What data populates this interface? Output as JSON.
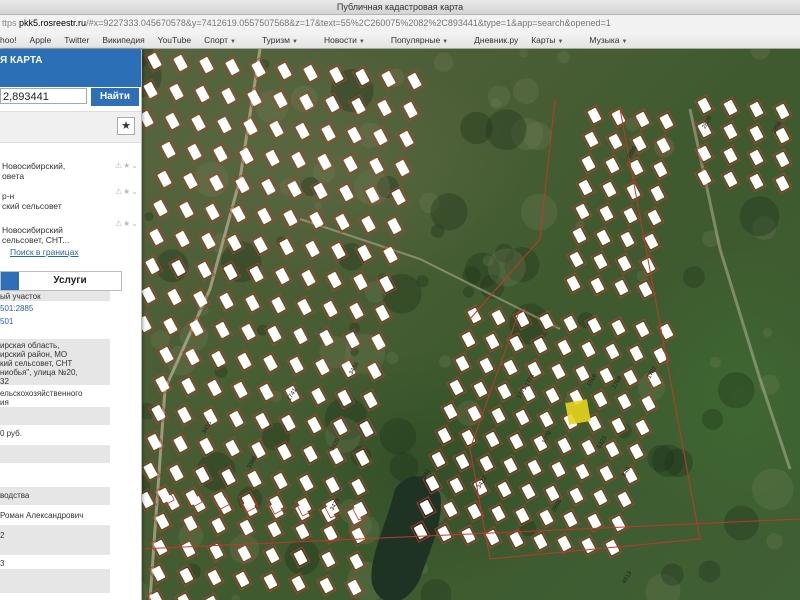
{
  "browser": {
    "window_title": "Публичная кадастровая карта",
    "url_scheme": "ttps",
    "url_host": "pkk5.rosreestr.ru",
    "url_path": "/#x=9227333.045670578&y=7412619.0557507568&z=17&text=55%2C260075%2082%2C893441&type=1&app=search&opened=1",
    "bookmarks": [
      {
        "label": "hoo!",
        "menu": false
      },
      {
        "label": "Apple",
        "menu": false
      },
      {
        "label": "Twitter",
        "menu": false
      },
      {
        "label": "Википедия",
        "menu": false
      },
      {
        "label": "YouTube",
        "menu": false
      },
      {
        "label": "Спорт",
        "menu": true
      },
      {
        "label": "Туризм",
        "menu": true
      },
      {
        "label": "Новости",
        "menu": true
      },
      {
        "label": "Популярные",
        "menu": true
      },
      {
        "label": "Дневник.ру",
        "menu": false
      },
      {
        "label": "Карты",
        "menu": true
      },
      {
        "label": "Музыка",
        "menu": true
      }
    ]
  },
  "panel": {
    "title": "Я КАРТА",
    "search_value": "2,893441",
    "search_button": "Найти",
    "star": "★",
    "tree": [
      {
        "lines": [
          "Новосибирский,",
          "овета"
        ]
      },
      {
        "lines": [
          "р-н",
          "ский сельсовет"
        ]
      },
      {
        "lines": [
          "Новосибирский",
          "сельсовет, СНТ..."
        ]
      }
    ],
    "tree_icons": "⚠★⌄",
    "boundary_link": "Поиск в границах",
    "tab_services": "Услуги",
    "info": {
      "type": "ый участок",
      "cad_number": "501:2885",
      "cad_block": "501",
      "address": [
        "ирская область,",
        "ирский район, МО",
        "кий сельсовет, СНТ",
        "ниобья\", улица №20,",
        "32"
      ],
      "category": [
        "ельскохозяйственного",
        "ия"
      ],
      "cost": "0 руб.",
      "usage": "водства",
      "owner": "Роман Александрович",
      "val_2": "2",
      "val_3": "3"
    }
  },
  "map": {
    "highlight_color": "#e6d31e",
    "boundary_color": "#c0392b",
    "center_labels": [
      "1774",
      "1771",
      "1769",
      "1768",
      "1762",
      "1779",
      "5323",
      "840",
      "841",
      "4813",
      "2866",
      "3424",
      "3420",
      "3434",
      "3416",
      "1741",
      "2856",
      "2829",
      "2898",
      "3422",
      "3388"
    ]
  }
}
